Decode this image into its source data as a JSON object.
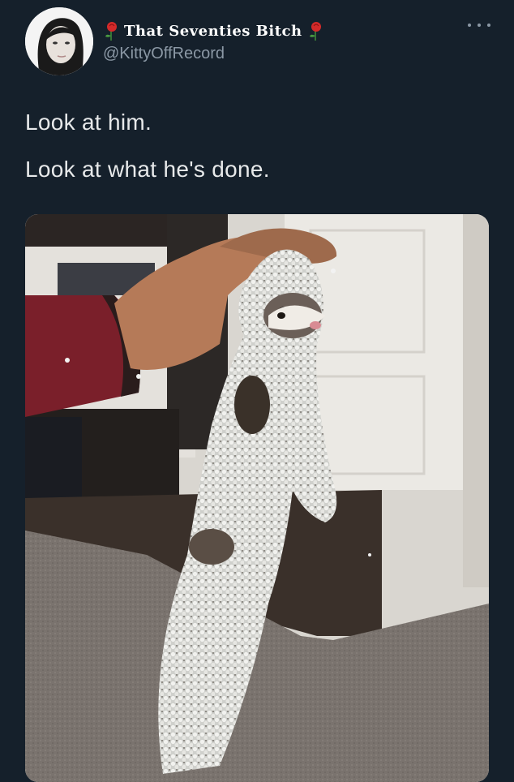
{
  "tweet": {
    "display_name": "That Seventies Bitch",
    "handle": "@KittyOffRecord",
    "text_lines": [
      "Look at him.",
      "Look at what he's done."
    ],
    "more_icon": "more-horizontal-icon",
    "name_emoji": "rose-icon"
  },
  "colors": {
    "background": "#15202b",
    "text_primary": "#e7e9ea",
    "text_secondary": "#8b98a5"
  },
  "media": {
    "subject": "ferret covered in white foam beads held up by a hand"
  }
}
